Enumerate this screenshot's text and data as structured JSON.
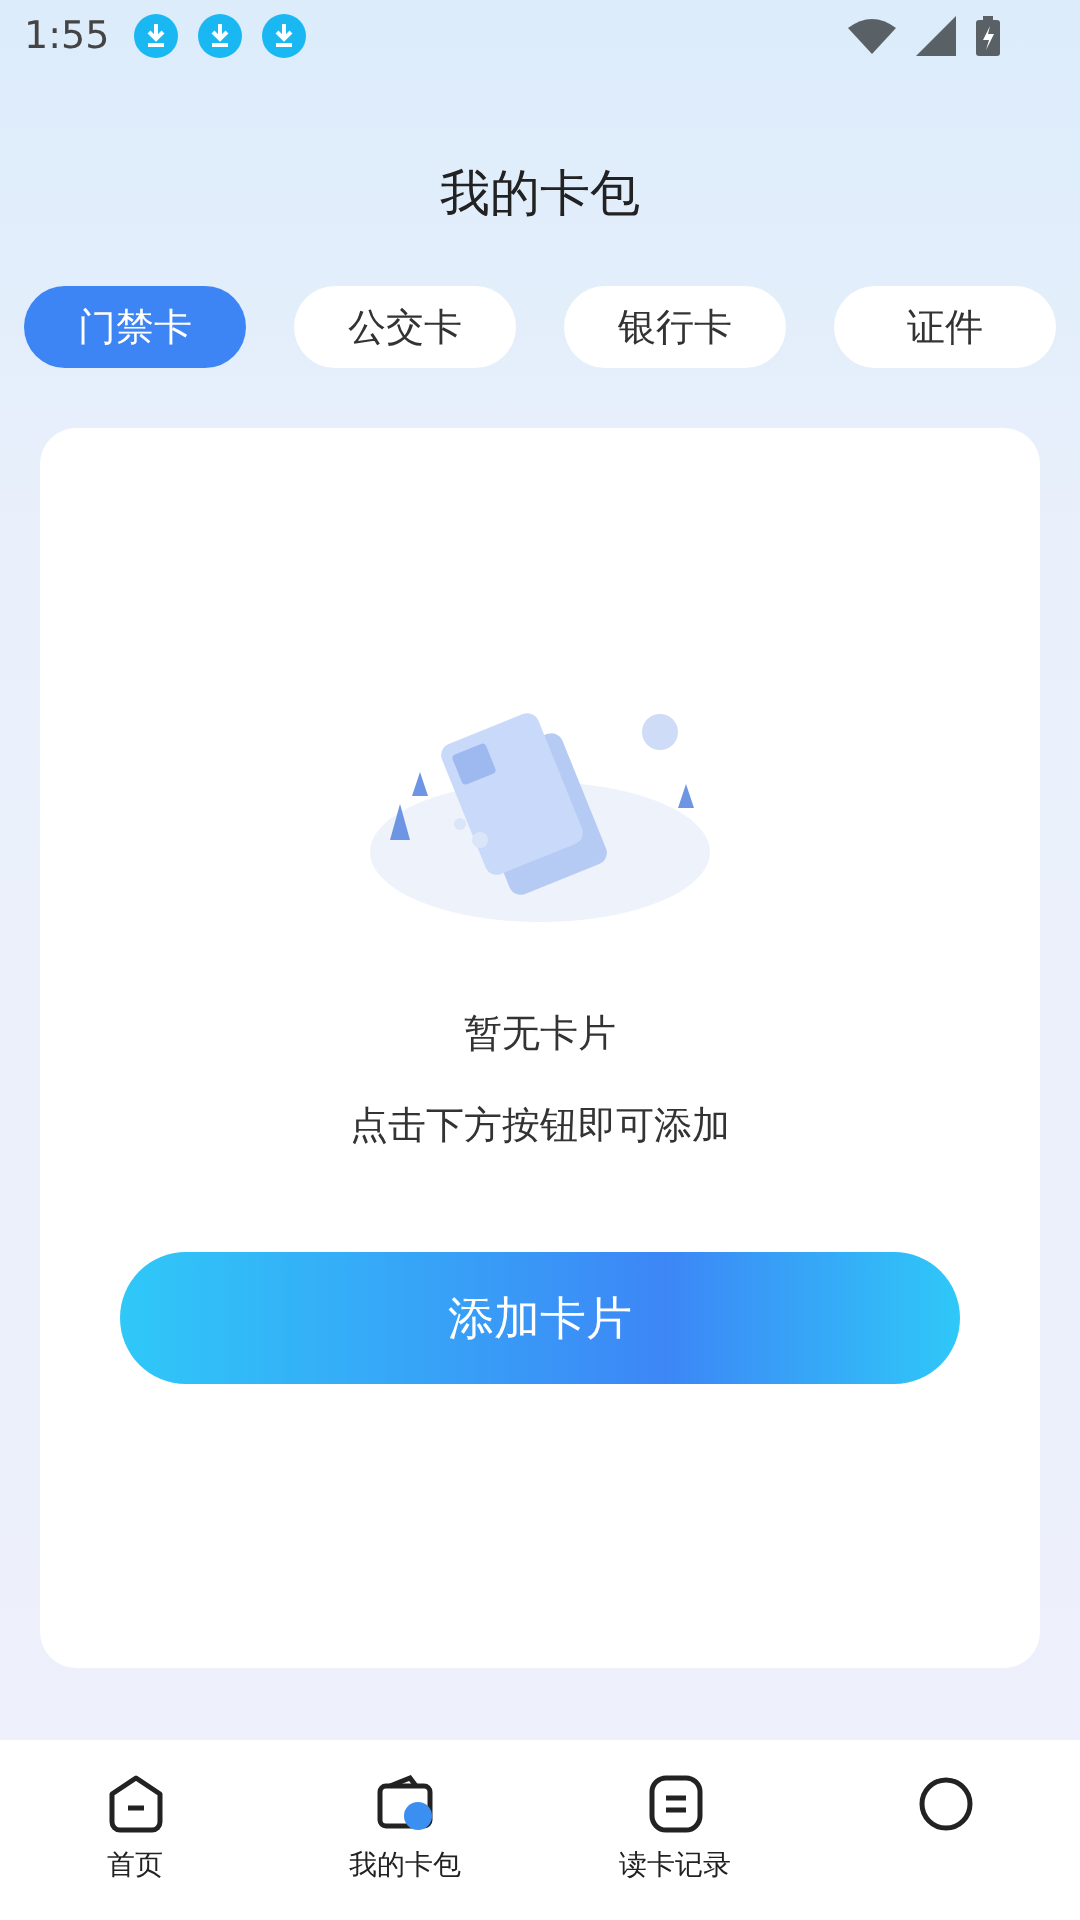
{
  "status_bar": {
    "time": "1:55",
    "notifications": [
      {
        "kind": "download"
      },
      {
        "kind": "download"
      },
      {
        "kind": "download"
      }
    ]
  },
  "title": "我的卡包",
  "tabs": [
    {
      "label": "门禁卡",
      "selected": true
    },
    {
      "label": "公交卡",
      "selected": false
    },
    {
      "label": "银行卡",
      "selected": false
    },
    {
      "label": "证件",
      "selected": false
    }
  ],
  "empty_state": {
    "title": "暂无卡片",
    "hint": "点击下方按钮即可添加"
  },
  "add_button": "添加卡片",
  "nav": [
    {
      "kind": "home",
      "label": "首页",
      "selected": false
    },
    {
      "kind": "wallet",
      "label": "我的卡包",
      "selected": true
    },
    {
      "kind": "records",
      "label": "读卡记录",
      "selected": false
    },
    {
      "kind": "profile",
      "selected": false
    }
  ]
}
